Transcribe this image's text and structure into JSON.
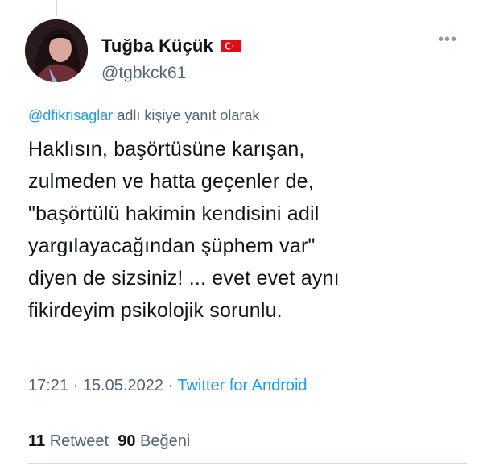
{
  "author": {
    "display_name": "Tuğba Küçük",
    "handle": "@tgbkck61",
    "flag_icon": "turkey-flag-icon",
    "avatar_icon": "profile-photo"
  },
  "reply": {
    "mention": "@dfikrisaglar",
    "suffix": " adlı kişiye yanıt olarak"
  },
  "tweet": {
    "text": "Haklısın, başörtüsüne karışan,\nzulmeden ve hatta geçenler de,\n\"başörtülü hakimin kendisini adil\nyargılayacağından şüphem var\"\ndiyen de sizsiniz! ... evet evet aynı\nfikirdeyim psikolojik sorunlu."
  },
  "meta": {
    "time": "17:21",
    "date": "15.05.2022",
    "separator": " · ",
    "source": "Twitter for Android"
  },
  "stats": {
    "retweets": "11",
    "retweets_label": "Retweet",
    "likes": "90",
    "likes_label": "Beğeni"
  },
  "colors": {
    "link": "#1d9bf0",
    "muted": "#536471",
    "text": "#0f1419"
  }
}
